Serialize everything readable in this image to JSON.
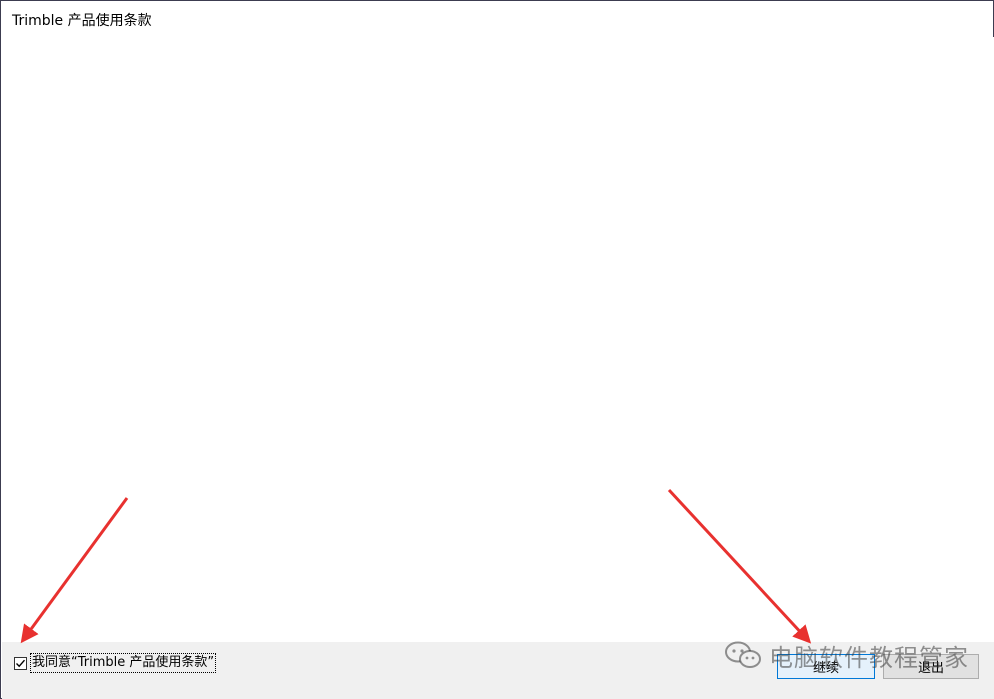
{
  "window": {
    "title": "Trimble 产品使用条款"
  },
  "footer": {
    "agree_checked": true,
    "agree_label": "我同意“Trimble 产品使用条款”",
    "continue_label": "继续",
    "exit_label": "退出"
  },
  "watermark": {
    "text": "电脑软件教程管家",
    "icon": "wechat-icon"
  },
  "annotations": {
    "arrow_color": "#e8312f",
    "arrow_count": 2
  }
}
